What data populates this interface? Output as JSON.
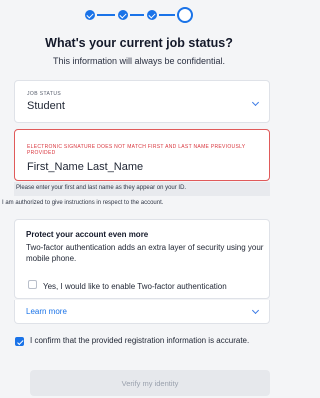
{
  "stepper": {
    "steps": [
      "complete",
      "complete",
      "complete",
      "current"
    ],
    "completed_count": 3,
    "total": 4
  },
  "header": {
    "title": "What's your current job status?",
    "subtitle": "This information will always be confidential."
  },
  "job_status": {
    "label": "JOB STATUS",
    "value": "Student",
    "icon": "chevron-down-icon"
  },
  "signature": {
    "error": "ELECTRONIC SIGNATURE DOES NOT MATCH FIRST AND LAST NAME PREVIOUSLY PROVIDED",
    "value": "First_Name Last_Name",
    "helper": "Please enter your first and last name as they appear on your ID."
  },
  "authorization_text": "I am authorized to give instructions in respect to the account.",
  "protect": {
    "title": "Protect your account even more",
    "description": "Two-factor authentication adds an extra layer of security using your mobile phone.",
    "twofa_label": "Yes, I would like to enable Two-factor authentication",
    "twofa_checked": false,
    "learn_more": "Learn more"
  },
  "confirm": {
    "label": "I confirm that the provided registration information is accurate.",
    "checked": true
  },
  "verify_button": "Verify my identity",
  "colors": {
    "accent": "#1a73e8",
    "error": "#d9363e",
    "background": "#f4f5f7"
  }
}
